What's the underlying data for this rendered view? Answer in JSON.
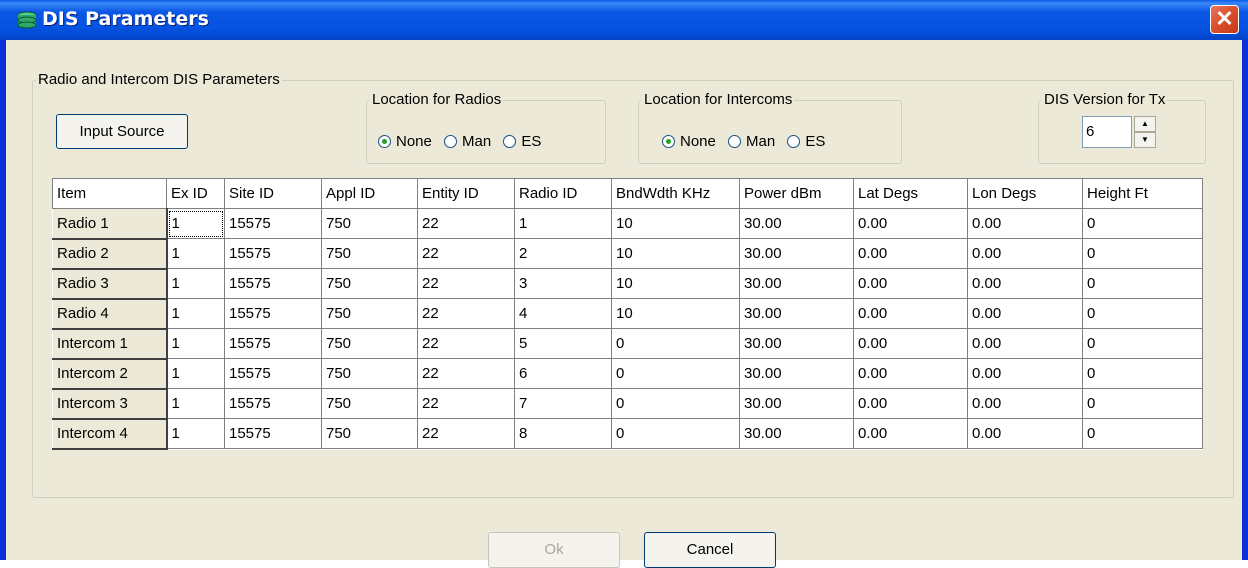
{
  "window": {
    "title": "DIS Parameters",
    "close_glyph": "✕"
  },
  "group_main": {
    "label": "Radio and Intercom DIS Parameters"
  },
  "input_source_button": "Input Source",
  "location_radios": {
    "label": "Location for Radios",
    "options": [
      "None",
      "Man",
      "ES"
    ],
    "selected": "None"
  },
  "location_intercoms": {
    "label": "Location for Intercoms",
    "options": [
      "None",
      "Man",
      "ES"
    ],
    "selected": "None"
  },
  "dis_version": {
    "label": "DIS Version for Tx",
    "value": "6",
    "up_glyph": "▲",
    "down_glyph": "▼"
  },
  "table": {
    "columns": [
      "Item",
      "Ex ID",
      "Site ID",
      "Appl ID",
      "Entity ID",
      "Radio ID",
      "BndWdth KHz",
      "Power dBm",
      "Lat Degs",
      "Lon Degs",
      "Height Ft"
    ],
    "rows": [
      [
        "Radio 1",
        "1",
        "15575",
        "750",
        "22",
        "1",
        "10",
        "30.00",
        "0.00",
        "0.00",
        "0"
      ],
      [
        "Radio 2",
        "1",
        "15575",
        "750",
        "22",
        "2",
        "10",
        "30.00",
        "0.00",
        "0.00",
        "0"
      ],
      [
        "Radio 3",
        "1",
        "15575",
        "750",
        "22",
        "3",
        "10",
        "30.00",
        "0.00",
        "0.00",
        "0"
      ],
      [
        "Radio 4",
        "1",
        "15575",
        "750",
        "22",
        "4",
        "10",
        "30.00",
        "0.00",
        "0.00",
        "0"
      ],
      [
        "Intercom 1",
        "1",
        "15575",
        "750",
        "22",
        "5",
        "0",
        "30.00",
        "0.00",
        "0.00",
        "0"
      ],
      [
        "Intercom 2",
        "1",
        "15575",
        "750",
        "22",
        "6",
        "0",
        "30.00",
        "0.00",
        "0.00",
        "0"
      ],
      [
        "Intercom 3",
        "1",
        "15575",
        "750",
        "22",
        "7",
        "0",
        "30.00",
        "0.00",
        "0.00",
        "0"
      ],
      [
        "Intercom 4",
        "1",
        "15575",
        "750",
        "22",
        "8",
        "0",
        "30.00",
        "0.00",
        "0.00",
        "0"
      ]
    ]
  },
  "buttons": {
    "ok": "Ok",
    "cancel": "Cancel"
  }
}
